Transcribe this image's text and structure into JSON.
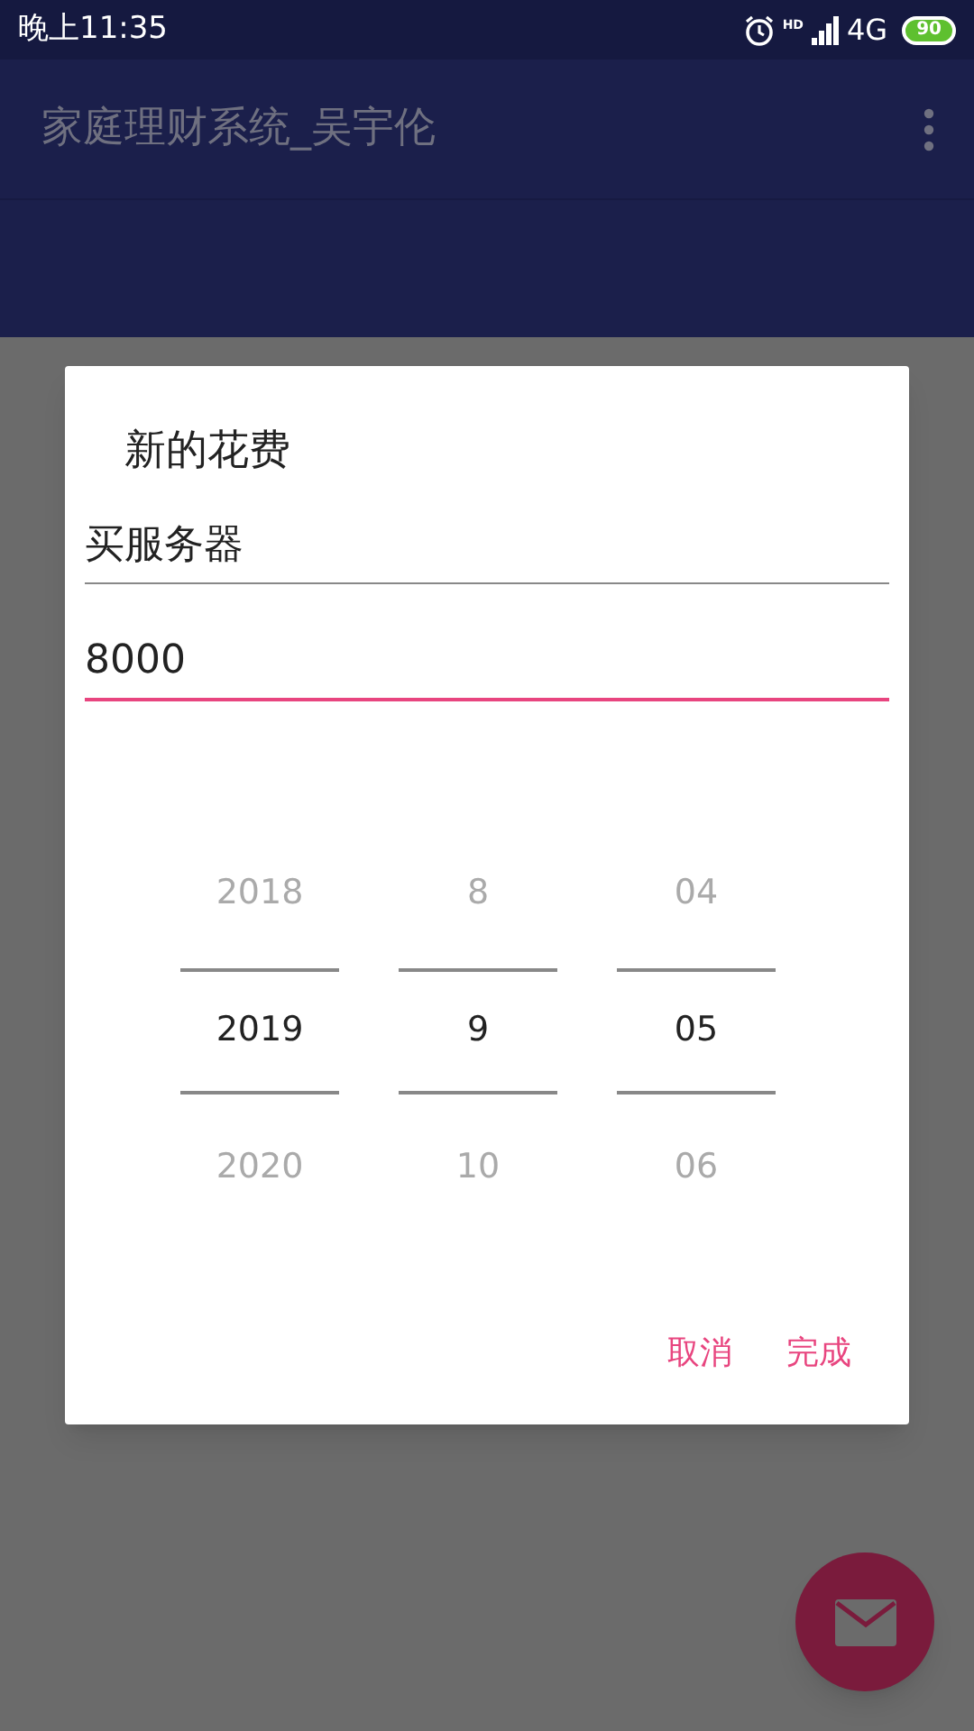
{
  "status_bar": {
    "time": "晚上11:35",
    "hd": "HD",
    "network": "4G",
    "battery": "90"
  },
  "app_bar": {
    "title": "家庭理财系统_吴宇伦"
  },
  "dialog": {
    "title": "新的花费",
    "fields": [
      {
        "value": "买服务器",
        "focused": false
      },
      {
        "value": "8000",
        "focused": true
      }
    ],
    "picker": [
      {
        "items": [
          {
            "label": "2018",
            "selected": false
          },
          {
            "label": "2019",
            "selected": true
          },
          {
            "label": "2020",
            "selected": false
          }
        ]
      },
      {
        "items": [
          {
            "label": "8",
            "selected": false
          },
          {
            "label": "9",
            "selected": true
          },
          {
            "label": "10",
            "selected": false
          }
        ]
      },
      {
        "items": [
          {
            "label": "04",
            "selected": false
          },
          {
            "label": "05",
            "selected": true
          },
          {
            "label": "06",
            "selected": false
          }
        ]
      }
    ],
    "buttons": [
      "取消",
      "完成"
    ]
  }
}
